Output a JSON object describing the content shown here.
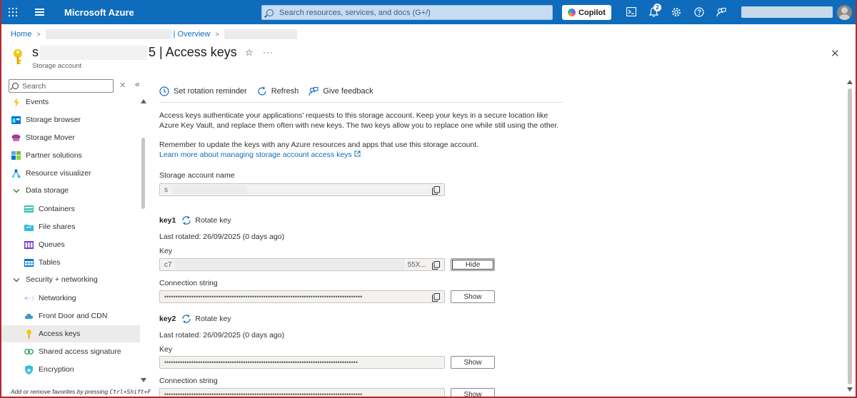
{
  "topbar": {
    "brand": "Microsoft Azure",
    "search_placeholder": "Search resources, services, and docs (G+/)",
    "copilot_label": "Copilot",
    "notification_count": "2",
    "icons": [
      "waffle-icon",
      "menu-icon",
      "cloud-shell-icon",
      "bell-icon",
      "settings-icon",
      "help-icon",
      "feedback-icon"
    ]
  },
  "breadcrumb": {
    "home": "Home",
    "overview": "| Overview"
  },
  "header": {
    "title_prefix": "s",
    "title_suffix": "5 | Access keys",
    "subtitle": "Storage account"
  },
  "sidebar": {
    "search_placeholder": "Search",
    "items": [
      {
        "label": "Events",
        "icon": "lightning-icon",
        "level": 1
      },
      {
        "label": "Storage browser",
        "icon": "storage-browser-icon",
        "level": 1
      },
      {
        "label": "Storage Mover",
        "icon": "storage-mover-icon",
        "level": 1
      },
      {
        "label": "Partner solutions",
        "icon": "partner-icon",
        "level": 1
      },
      {
        "label": "Resource visualizer",
        "icon": "visualizer-icon",
        "level": 1
      },
      {
        "label": "Data storage",
        "icon": "chevron-down-icon",
        "level": 1
      },
      {
        "label": "Containers",
        "icon": "containers-icon",
        "level": 2
      },
      {
        "label": "File shares",
        "icon": "file-shares-icon",
        "level": 2
      },
      {
        "label": "Queues",
        "icon": "queues-icon",
        "level": 2
      },
      {
        "label": "Tables",
        "icon": "tables-icon",
        "level": 2
      },
      {
        "label": "Security + networking",
        "icon": "chevron-down-icon",
        "level": 1
      },
      {
        "label": "Networking",
        "icon": "networking-icon",
        "level": 2
      },
      {
        "label": "Front Door and CDN",
        "icon": "front-door-icon",
        "level": 2
      },
      {
        "label": "Access keys",
        "icon": "key-icon",
        "level": 2,
        "active": true
      },
      {
        "label": "Shared access signature",
        "icon": "sas-icon",
        "level": 2
      },
      {
        "label": "Encryption",
        "icon": "encryption-icon",
        "level": 2
      }
    ],
    "footer_prefix": "Add or remove favorites by pressing ",
    "footer_shortcut": "Ctrl+Shift+F"
  },
  "toolbar": {
    "rotation_reminder": "Set rotation reminder",
    "refresh": "Refresh",
    "feedback": "Give feedback"
  },
  "content": {
    "intro": "Access keys authenticate your applications' requests to this storage account. Keep your keys in a secure location like Azure Key Vault, and replace them often with new keys. The two keys allow you to replace one while still using the other.",
    "reminder": "Remember to update the keys with any Azure resources and apps that use this storage account.",
    "learn_more": "Learn more about managing storage account access keys",
    "account_name_label": "Storage account name",
    "account_name_value": "s",
    "key1": {
      "name": "key1",
      "rotate": "Rotate key",
      "last_rotated": "Last rotated: 26/09/2025 (0 days ago)",
      "key_label": "Key",
      "key_prefix": "c7",
      "key_suffix": "55X...",
      "key_button": "Hide",
      "conn_label": "Connection string",
      "conn_value": "••••••••••••••••••••••••••••••••••••••••••••••••••••••••••••••••••••••••••••••••••••••••",
      "conn_button": "Show"
    },
    "key2": {
      "name": "key2",
      "rotate": "Rotate key",
      "last_rotated": "Last rotated: 26/09/2025 (0 days ago)",
      "key_label": "Key",
      "key_value": "••••••••••••••••••••••••••••••••••••••••••••••••••••••••••••••••••••••••••••••••••••••",
      "key_button": "Show",
      "conn_label": "Connection string",
      "conn_value": "••••••••••••••••••••••••••••••••••••••••••••••••••••••••••••••••••••••••••••••••••••••••",
      "conn_button": "Show"
    }
  },
  "colors": {
    "brand_blue": "#0f6cbd",
    "link": "#0f6cbd",
    "active_nav": "#edebe9",
    "frame": "#b4282e"
  }
}
